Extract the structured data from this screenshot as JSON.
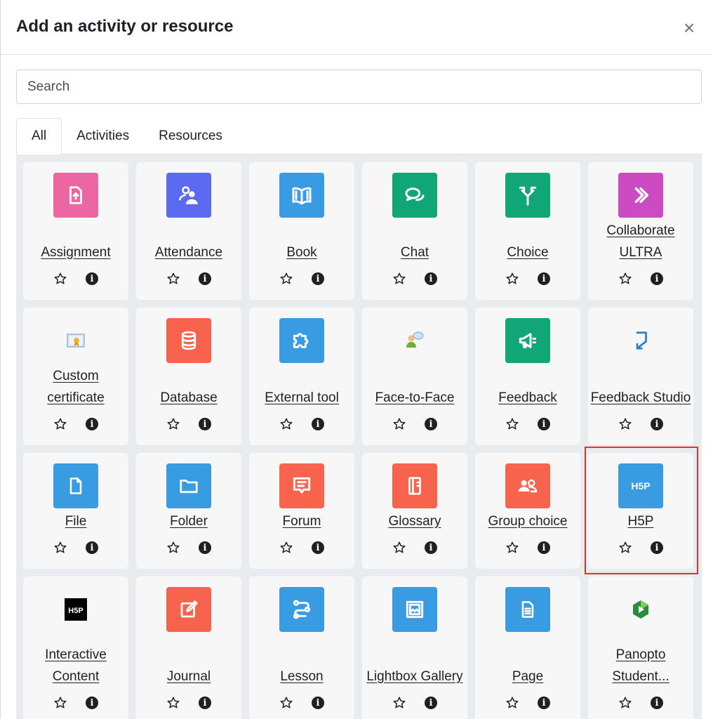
{
  "modal": {
    "title": "Add an activity or resource"
  },
  "search": {
    "placeholder": "Search"
  },
  "tabs": [
    "All",
    "Activities",
    "Resources"
  ],
  "colors": {
    "pink": "#eb66a2",
    "indigo": "#5b6af0",
    "blue": "#399be2",
    "green": "#11a676",
    "magenta": "#cd4bc2",
    "red": "#f7634d",
    "highlight": "#e0342a"
  },
  "items": [
    {
      "label": "Assignment",
      "icon": "assignment-icon",
      "color": "#eb66a2"
    },
    {
      "label": "Attendance",
      "icon": "attendance-icon",
      "color": "#5b6af0"
    },
    {
      "label": "Book",
      "icon": "book-icon",
      "color": "#399be2"
    },
    {
      "label": "Chat",
      "icon": "chat-icon",
      "color": "#11a676"
    },
    {
      "label": "Choice",
      "icon": "choice-icon",
      "color": "#11a676"
    },
    {
      "label": "Collaborate ULTRA",
      "icon": "collaborate-icon",
      "color": "#cd4bc2"
    },
    {
      "label": "Custom certificate",
      "icon": "certificate-icon",
      "color": ""
    },
    {
      "label": "Database",
      "icon": "database-icon",
      "color": "#f7634d"
    },
    {
      "label": "External tool",
      "icon": "puzzle-icon",
      "color": "#399be2"
    },
    {
      "label": "Face-to-Face",
      "icon": "face-to-face-icon",
      "color": ""
    },
    {
      "label": "Feedback",
      "icon": "megaphone-icon",
      "color": "#11a676"
    },
    {
      "label": "Feedback Studio",
      "icon": "feedback-studio-icon",
      "color": ""
    },
    {
      "label": "File",
      "icon": "file-icon",
      "color": "#399be2"
    },
    {
      "label": "Folder",
      "icon": "folder-icon",
      "color": "#399be2"
    },
    {
      "label": "Forum",
      "icon": "forum-icon",
      "color": "#f7634d"
    },
    {
      "label": "Glossary",
      "icon": "glossary-icon",
      "color": "#f7634d"
    },
    {
      "label": "Group choice",
      "icon": "group-icon",
      "color": "#f7634d"
    },
    {
      "label": "H5P",
      "icon": "h5p-icon",
      "color": "#399be2"
    },
    {
      "label": "Interactive Content",
      "icon": "h5p-black-icon",
      "color": ""
    },
    {
      "label": "Journal",
      "icon": "journal-icon",
      "color": "#f7634d"
    },
    {
      "label": "Lesson",
      "icon": "lesson-icon",
      "color": "#399be2"
    },
    {
      "label": "Lightbox Gallery",
      "icon": "gallery-icon",
      "color": "#399be2"
    },
    {
      "label": "Page",
      "icon": "page-icon",
      "color": "#399be2"
    },
    {
      "label": "Panopto Student...",
      "icon": "panopto-icon",
      "color": ""
    }
  ]
}
